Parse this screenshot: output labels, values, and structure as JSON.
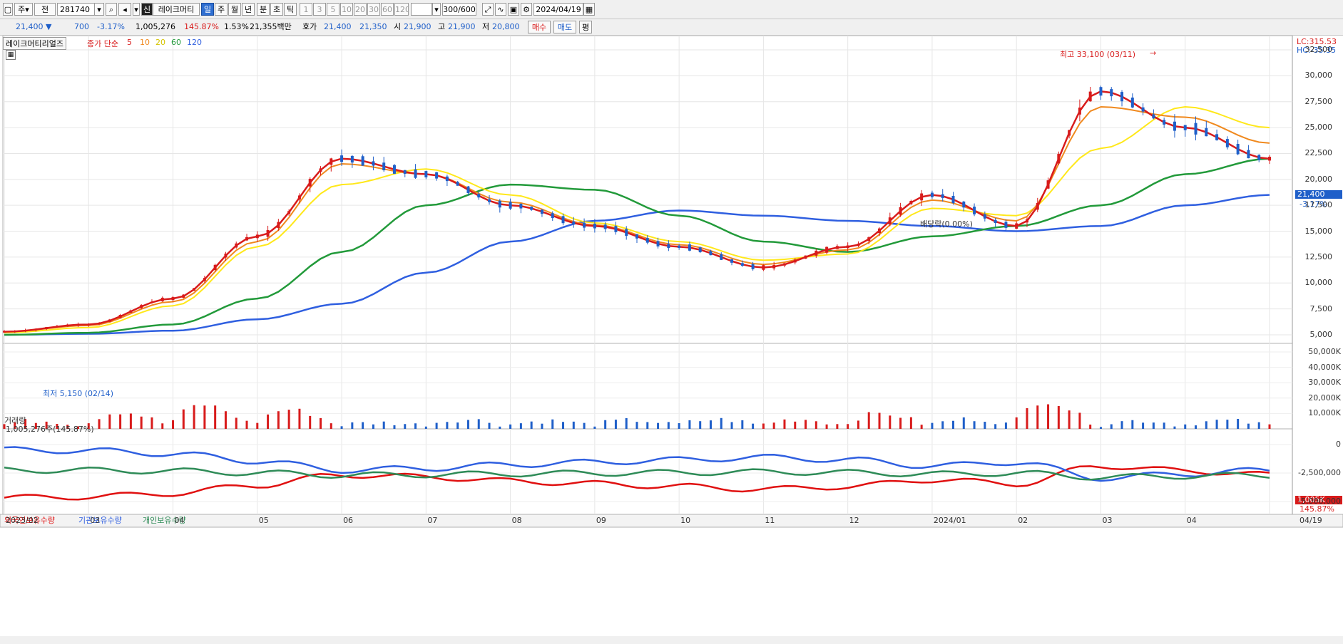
{
  "toolbar": {
    "market_label": "주",
    "mode_label": "전",
    "code_value": "281740",
    "name_badge": "신",
    "stock_name": "레이크머티",
    "periods": [
      "일",
      "주",
      "월",
      "년",
      "분",
      "초",
      "틱"
    ],
    "selected_period": "일",
    "intervals": [
      "1",
      "3",
      "5",
      "10",
      "20",
      "30",
      "60",
      "120"
    ],
    "count_value": "300/600",
    "date_value": "2024/04/19"
  },
  "quote": {
    "price": "21,400",
    "change_arrow": "▼",
    "change": "700",
    "change_pct": "-3.17%",
    "volume": "1,005,276",
    "volume_ratio": "145.87%",
    "turnover": "1.53%",
    "amount": "21,355백만",
    "bid_label": "호가",
    "ask_price": "21,400",
    "bid_price": "21,350",
    "open_label": "시",
    "open": "21,900",
    "high_label": "고",
    "high": "21,900",
    "low_label": "저",
    "low": "20,800",
    "buy_label": "매수",
    "sell_label": "매도",
    "eval_label": "평"
  },
  "price_panel": {
    "title": "레이크머티리얼즈",
    "ma_label": "종가 단순",
    "ma_periods": [
      "5",
      "10",
      "20",
      "60",
      "120"
    ],
    "lc_label": "LC:315.53",
    "hc_label": "HC:-35.35",
    "high_annotation": "최고 33,100 (03/11)",
    "low_annotation": "최저 5,150 (02/14)",
    "dividend_annotation": "배당락(0.00%)",
    "current_price_tag": "21,400",
    "current_pct_tag": "-3.17%",
    "y_ticks": [
      "32,500",
      "30,000",
      "27,500",
      "25,000",
      "22,500",
      "20,000",
      "17,500",
      "15,000",
      "12,500",
      "10,000",
      "7,500",
      "5,000"
    ]
  },
  "volume_panel": {
    "title": "거래량",
    "value_label": "1,005,276주(145.87%)",
    "volume_tag": "1,005K",
    "pct_tag": "145.87%",
    "y_ticks": [
      "50,000K",
      "40,000K",
      "30,000K",
      "20,000K",
      "10,000K"
    ]
  },
  "holding_panel": {
    "legend": [
      "외국인보유수량",
      "기관보유수량",
      "개인보유수량"
    ],
    "y_ticks": [
      "0",
      "-2,500,000",
      "-5,000,000"
    ]
  },
  "x_axis": [
    "2023/02",
    "03",
    "04",
    "05",
    "06",
    "07",
    "08",
    "09",
    "10",
    "11",
    "12",
    "2024/01",
    "02",
    "03",
    "04",
    "04/19"
  ],
  "colors": {
    "ma5": "#d81b1b",
    "ma10": "#f0891e",
    "ma20": "#ffe81a",
    "ma60": "#229a3a",
    "ma120": "#2f5fe0",
    "up": "#d81b1b",
    "down": "#1f5fc9",
    "foreign": "#e01010",
    "institution": "#2f5fe0",
    "individual": "#2e8b57"
  },
  "chart_data": {
    "type": "line",
    "title": "레이크머티리얼즈",
    "x": [
      "2023/02",
      "03",
      "04",
      "05",
      "06",
      "07",
      "08",
      "09",
      "10",
      "11",
      "12",
      "2024/01",
      "02",
      "03",
      "04",
      "04/19"
    ],
    "series": [
      {
        "name": "5",
        "values": [
          5300,
          6000,
          8500,
          14500,
          22000,
          20500,
          17500,
          15500,
          13500,
          11500,
          13500,
          18500,
          15500,
          28500,
          25000,
          22000
        ]
      },
      {
        "name": "10",
        "values": [
          5300,
          5900,
          8200,
          14000,
          21500,
          20500,
          17800,
          15600,
          13700,
          11800,
          13200,
          18000,
          16000,
          27000,
          26000,
          23500
        ]
      },
      {
        "name": "20",
        "values": [
          5200,
          5700,
          7800,
          13500,
          19500,
          21000,
          18500,
          15800,
          14000,
          12200,
          12800,
          17200,
          16500,
          23000,
          27000,
          25000
        ]
      },
      {
        "name": "60",
        "values": [
          5000,
          5200,
          6000,
          8500,
          13000,
          17500,
          19500,
          19000,
          16500,
          14000,
          13000,
          14500,
          15500,
          17500,
          20500,
          22000
        ]
      },
      {
        "name": "120",
        "values": [
          5000,
          5100,
          5400,
          6500,
          8000,
          11000,
          14000,
          16000,
          17000,
          16500,
          16000,
          15500,
          15000,
          15500,
          17500,
          18500
        ]
      }
    ],
    "ylim": [
      5000,
      32500
    ],
    "volume_ylim": [
      0,
      50000
    ],
    "holding_ylim": [
      -5000000,
      0
    ]
  }
}
